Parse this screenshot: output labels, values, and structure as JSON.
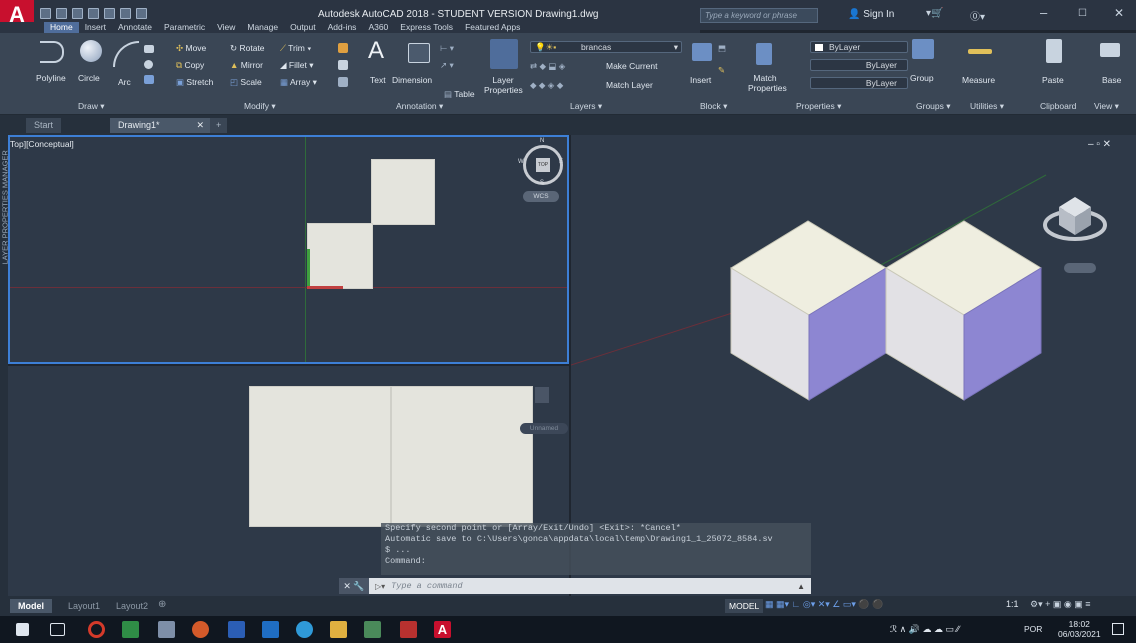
{
  "titlebar": {
    "app_letter": "A",
    "title": "Autodesk AutoCAD 2018 - STUDENT VERSION   Drawing1.dwg",
    "search_placeholder": "Type a keyword or phrase",
    "sign_in": "Sign In"
  },
  "ribbon_tabs": [
    "Home",
    "Insert",
    "Annotate",
    "Parametric",
    "View",
    "Manage",
    "Output",
    "Add-ins",
    "A360",
    "Express Tools",
    "Featured Apps"
  ],
  "draw": {
    "polyline": "Polyline",
    "circle": "Circle",
    "arc": "Arc",
    "panel": "Draw ▾"
  },
  "modify": {
    "move": "Move",
    "rotate": "Rotate",
    "trim": "Trim ▾",
    "copy": "Copy",
    "mirror": "Mirror",
    "fillet": "Fillet ▾",
    "stretch": "Stretch",
    "scale": "Scale",
    "array": "Array ▾",
    "panel": "Modify ▾"
  },
  "annotation": {
    "text": "Text",
    "dimension": "Dimension",
    "table": "Table",
    "panel": "Annotation ▾"
  },
  "layers": {
    "layer_properties": "Layer Properties",
    "current_layer": "brancas",
    "make_current": "Make Current",
    "match_layer": "Match Layer",
    "panel": "Layers ▾"
  },
  "block": {
    "insert": "Insert",
    "panel": "Block ▾"
  },
  "properties": {
    "match_properties": "Match Properties",
    "color": "ByLayer",
    "linetype": "ByLayer",
    "lineweight": "ByLayer",
    "panel": "Properties ▾"
  },
  "groups": {
    "group": "Group",
    "panel": "Groups ▾"
  },
  "utilities": {
    "measure": "Measure",
    "panel": "Utilities ▾"
  },
  "clipboard": {
    "paste": "Paste",
    "panel": "Clipboard"
  },
  "view": {
    "base": "Base",
    "panel": "View ▾"
  },
  "doctabs": {
    "start": "Start",
    "drawing": "Drawing1*"
  },
  "viewport1": {
    "label": "Top][Conceptual]",
    "compass_n": "N",
    "compass_s": "S",
    "compass_e": "E",
    "compass_w": "W",
    "compass_top": "TOP",
    "wcs": "WCS"
  },
  "viewport2": {
    "wcs": "Unnamed"
  },
  "palette": {
    "label": "LAYER PROPERTIES MANAGER"
  },
  "command": {
    "history": [
      "Specify second point or [Array/Exit/Undo] <Exit>: *Cancel*",
      "Automatic save to C:\\Users\\gonca\\appdata\\local\\temp\\Drawing1_1_25072_8584.sv",
      "$ ...",
      "Command:"
    ],
    "placeholder": "Type a command"
  },
  "layout_tabs": [
    "Model",
    "Layout1",
    "Layout2"
  ],
  "status": {
    "model": "MODEL",
    "scale": "1:1"
  },
  "taskbar": {
    "lang": "POR",
    "time": "18:02",
    "date": "06/03/2021"
  },
  "colors": {
    "accent": "#3d7fd6",
    "cube_top": "#efeee0",
    "cube_left": "#e2e1e5",
    "cube_right": "#8d86d2",
    "logo": "#c8102e"
  }
}
